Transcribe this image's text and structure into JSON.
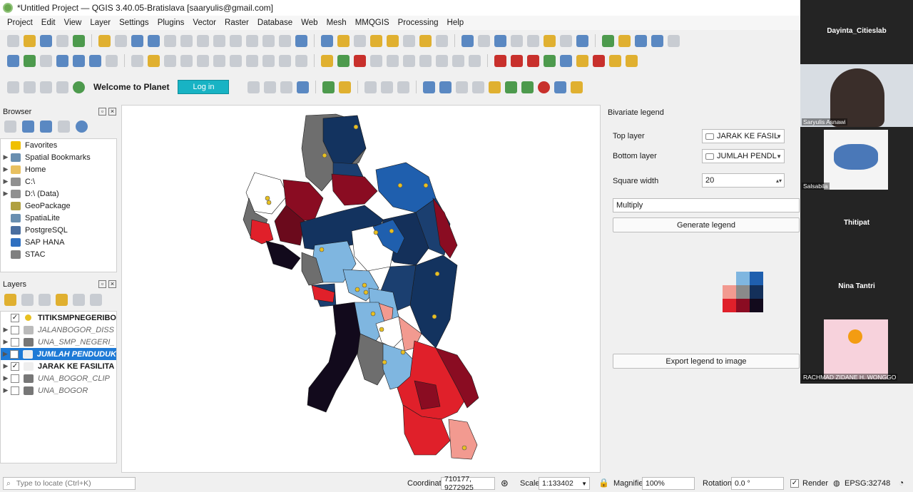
{
  "window": {
    "title": "*Untitled Project — QGIS 3.40.05-Bratislava [saaryulis@gmail.com]"
  },
  "menu": [
    "Project",
    "Edit",
    "View",
    "Layer",
    "Settings",
    "Plugins",
    "Vector",
    "Raster",
    "Database",
    "Web",
    "Mesh",
    "MMQGIS",
    "Processing",
    "Help"
  ],
  "planet": {
    "welcome": "Welcome to Planet",
    "login": "Log in"
  },
  "browser": {
    "title": "Browser",
    "items": [
      {
        "label": "Favorites",
        "icon": "star-icon",
        "color": "#f0c000",
        "expand": false
      },
      {
        "label": "Spatial Bookmarks",
        "icon": "bookmark-icon",
        "color": "#6a8fb0",
        "expand": true
      },
      {
        "label": "Home",
        "icon": "folder-icon",
        "color": "#e8c060",
        "expand": true
      },
      {
        "label": "C:\\",
        "icon": "drive-icon",
        "color": "#909090",
        "expand": true
      },
      {
        "label": "D:\\ (Data)",
        "icon": "drive-icon",
        "color": "#909090",
        "expand": true
      },
      {
        "label": "GeoPackage",
        "icon": "geopackage-icon",
        "color": "#b0a040",
        "expand": false
      },
      {
        "label": "SpatiaLite",
        "icon": "spatialite-icon",
        "color": "#6a8fb0",
        "expand": false
      },
      {
        "label": "PostgreSQL",
        "icon": "postgresql-icon",
        "color": "#4a6ea0",
        "expand": false
      },
      {
        "label": "SAP HANA",
        "icon": "saphana-icon",
        "color": "#3070c0",
        "expand": false
      },
      {
        "label": "STAC",
        "icon": "stac-icon",
        "color": "#808080",
        "expand": false
      }
    ]
  },
  "layers": {
    "title": "Layers",
    "items": [
      {
        "label": "TITIKSMPNEGERIBO",
        "checked": true,
        "style": "bold",
        "icon": "point-layer-icon",
        "selected": false
      },
      {
        "label": "JALANBOGOR_DISS",
        "checked": false,
        "style": "ital",
        "icon": "line-layer-icon",
        "selected": false
      },
      {
        "label": "UNA_SMP_NEGERI_",
        "checked": false,
        "style": "ital",
        "icon": "raster-layer-icon",
        "selected": false
      },
      {
        "label": "JUMLAH PENDUDUK",
        "checked": true,
        "style": "bold ital",
        "icon": "polygon-layer-icon",
        "selected": true
      },
      {
        "label": "JARAK KE FASILITA",
        "checked": true,
        "style": "bold",
        "icon": "polygon-layer-icon",
        "selected": false
      },
      {
        "label": "UNA_BOGOR_CLIP",
        "checked": false,
        "style": "ital",
        "icon": "raster-layer-icon",
        "selected": false
      },
      {
        "label": "UNA_BOGOR",
        "checked": false,
        "style": "ital",
        "icon": "raster-layer-icon",
        "selected": false
      }
    ]
  },
  "bivariate": {
    "title": "Bivariate legend",
    "top_label": "Top layer",
    "top_value": "JARAK KE FASIL",
    "bottom_label": "Bottom layer",
    "bottom_value": "JUMLAH PENDL",
    "width_label": "Square width",
    "width_value": "20",
    "blend_value": "Multiply",
    "generate": "Generate legend",
    "export": "Export legend to image",
    "grid_colors": [
      [
        "#ffffff",
        "#7fb6e0",
        "#1f5fae"
      ],
      [
        "#f29a90",
        "#8a8a8a",
        "#14305a"
      ],
      [
        "#e0202a",
        "#8a0c22",
        "#120a1c"
      ]
    ]
  },
  "status": {
    "locate_placeholder": "Type to locate (Ctrl+K)",
    "coord_label": "Coordinate",
    "coord_value": "710177, 9272925",
    "scale_label": "Scale",
    "scale_value": "1:133402",
    "magnifier_label": "Magnifier",
    "magnifier_value": "100%",
    "rotation_label": "Rotation",
    "rotation_value": "0.0 °",
    "render_label": "Render",
    "crs": "EPSG:32748"
  },
  "video": {
    "p1": "Dayinta_Citieslab",
    "p2_sub": "Saryulis Asnawi",
    "p3_sub": "Salsabila",
    "p4": "Thitipat",
    "p5": "Nina Tantri",
    "p6_sub": "RACHMAD ZIDANE H. WONGGO"
  },
  "colors": {
    "accent": "#1e7ad6",
    "login": "#18b3c4",
    "point": "#e8c020"
  }
}
